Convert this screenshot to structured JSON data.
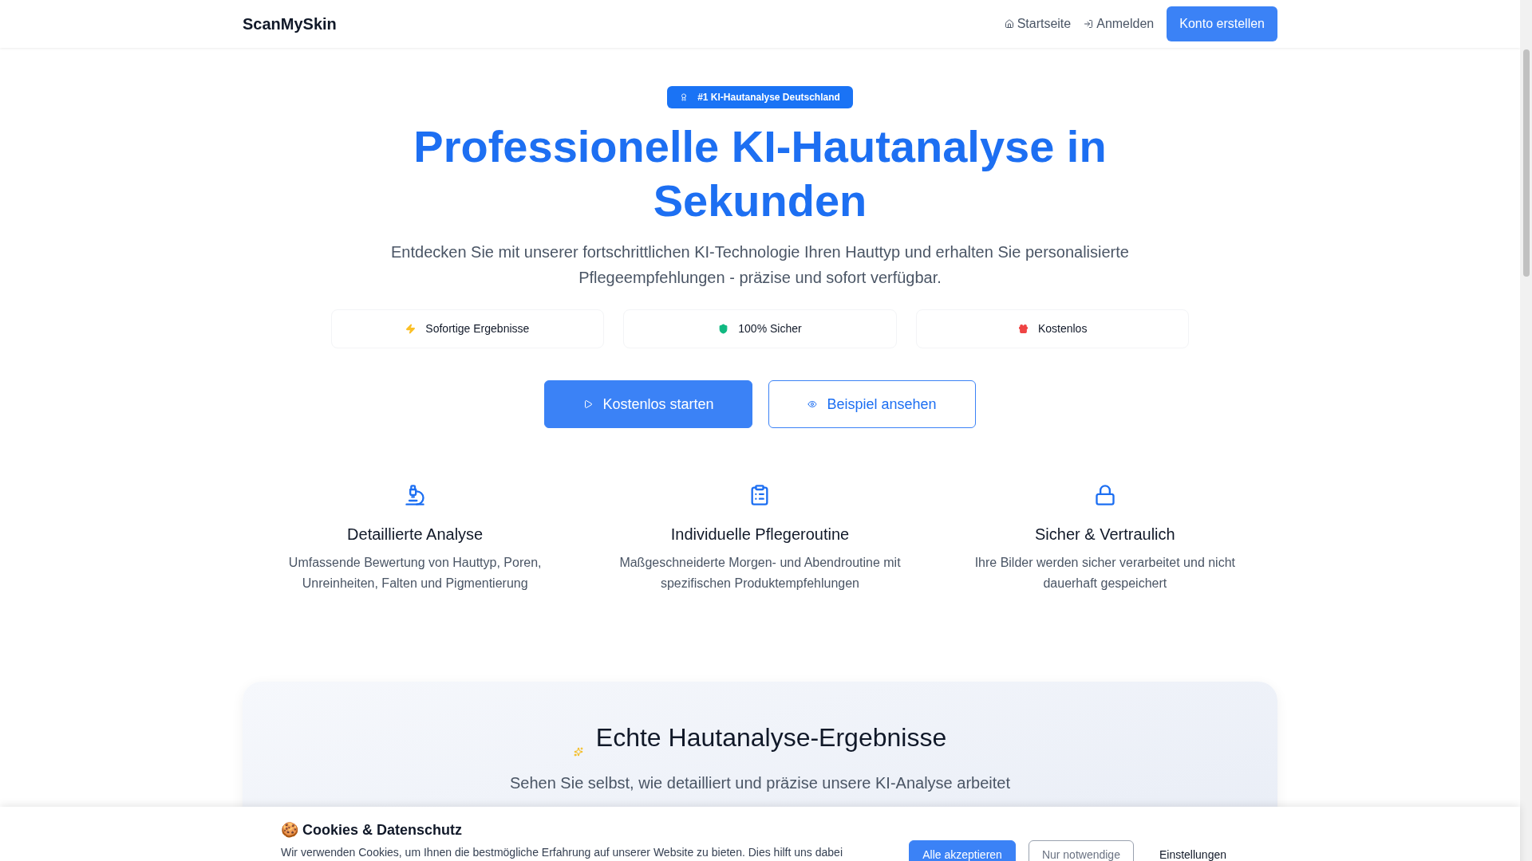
{
  "header": {
    "brand": "ScanMySkin",
    "nav": [
      {
        "label": "Startseite"
      },
      {
        "label": "Anmelden"
      }
    ],
    "cta": "Konto erstellen"
  },
  "hero": {
    "badge": "#1 KI-Hautanalyse Deutschland",
    "title": "Professionelle KI-Hautanalyse in Sekunden",
    "subtitle": "Entdecken Sie mit unserer fortschrittlichen KI-Technologie Ihren Hauttyp und erhalten Sie personalisierte Pflegeempfehlungen - präzise und sofort verfügbar.",
    "highlights": [
      {
        "label": "Sofortige Ergebnisse",
        "color": "#fbbf24"
      },
      {
        "label": "100% Sicher",
        "color": "#10b981"
      },
      {
        "label": "Kostenlos",
        "color": "#ef4444"
      }
    ],
    "buttons": [
      {
        "label": "Kostenlos starten",
        "kind": "primary"
      },
      {
        "label": "Beispiel ansehen",
        "kind": "outline"
      }
    ]
  },
  "features": [
    {
      "title": "Detaillierte Analyse",
      "text": "Umfassende Bewertung von Hauttyp, Poren, Unreinheiten, Falten und Pigmentierung"
    },
    {
      "title": "Individuelle Pflegeroutine",
      "text": "Maßgeschneiderte Morgen- und Abendroutine mit spezifischen Produktempfehlungen"
    },
    {
      "title": "Sicher & Vertraulich",
      "text": "Ihre Bilder werden sicher verarbeitet und nicht dauerhaft gespeichert"
    }
  ],
  "results": {
    "title": "Echte Hautanalyse-Ergebnisse",
    "subtitle": "Sehen Sie selbst, wie detailliert und präzise unsere KI-Analyse arbeitet"
  },
  "cookie_banner": {
    "title": "🍪 Cookies & Datenschutz",
    "text": "Wir verwenden Cookies, um Ihnen die bestmögliche Erfahrung auf unserer Website zu bieten. Dies hilft uns dabei",
    "buttons": [
      {
        "label": "Alle akzeptieren",
        "kind": "primary"
      },
      {
        "label": "Nur notwendige",
        "kind": "outline"
      },
      {
        "label": "Einstellungen",
        "kind": "link"
      }
    ]
  }
}
